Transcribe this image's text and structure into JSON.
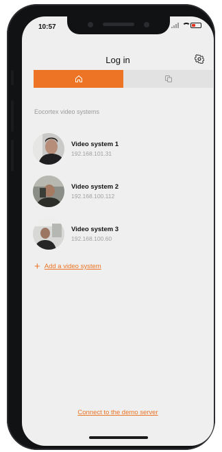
{
  "status_bar": {
    "time": "10:57"
  },
  "header": {
    "title": "Log in",
    "settings_icon": "gear-icon"
  },
  "tabs": [
    {
      "icon": "home-icon",
      "active": true
    },
    {
      "icon": "cloud-copy-icon",
      "active": false
    }
  ],
  "section_label": "Eocortex video systems",
  "systems": [
    {
      "name": "Video system 1",
      "ip": "192.168.101.31"
    },
    {
      "name": "Video system 2",
      "ip": "192.168.100.112"
    },
    {
      "name": "Video system 3",
      "ip": "192.168.100.60"
    }
  ],
  "add_system_label": "Add a video system",
  "demo_link": "Connect to the demo server",
  "colors": {
    "accent": "#ec7424",
    "background": "#efefef",
    "tab_inactive": "#e2e2e2"
  }
}
